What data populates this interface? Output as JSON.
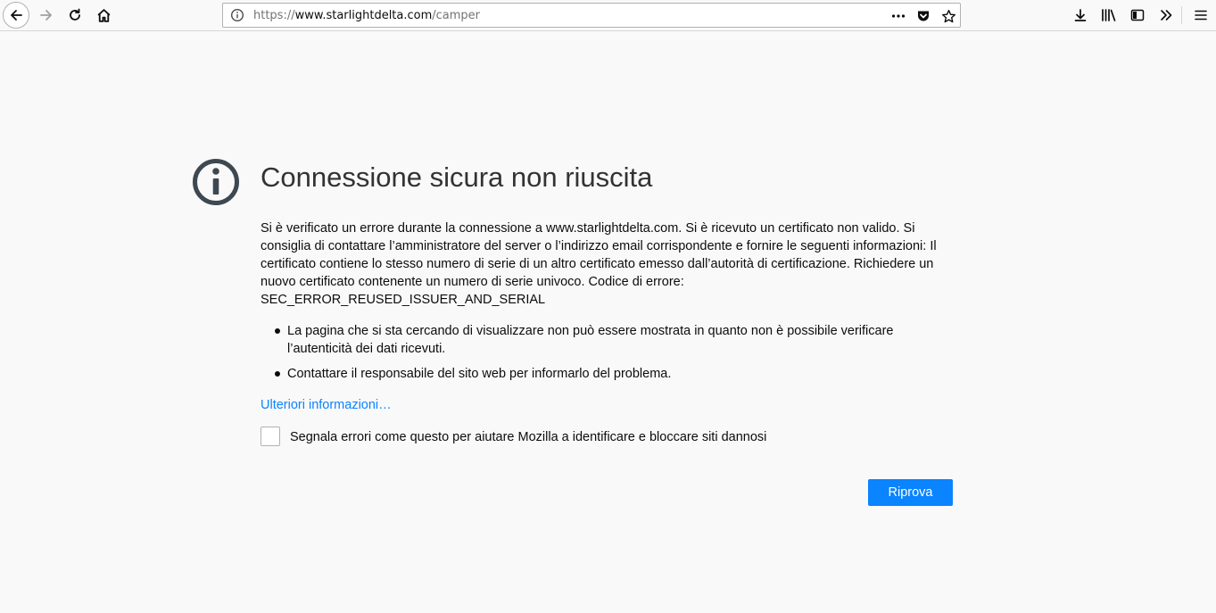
{
  "browser": {
    "url_scheme": "https://",
    "url_host": "www.starlightdelta.com",
    "url_path": "/camper",
    "icons": [
      "back-arrow-icon",
      "forward-arrow-icon",
      "reload-icon",
      "home-icon",
      "info-icon",
      "more-icon",
      "pocket-icon",
      "star-icon",
      "download-icon",
      "library-icon",
      "sidebar-icon",
      "overflow-chevron-icon",
      "hamburger-menu-icon"
    ]
  },
  "error": {
    "icon": "info-circle-icon",
    "title": "Connessione sicura non riuscita",
    "description": "Si è verificato un errore durante la connessione a www.starlightdelta.com. Si è ricevuto un certificato non valido. Si consiglia di contattare l’amministratore del server o l’indirizzo email corrispondente e fornire le seguenti informazioni: Il certificato contiene lo stesso numero di serie di un altro certificato emesso dall’autorità di certificazione. Richiedere un nuovo certificato contenente un numero di serie univoco. Codice di errore:",
    "error_code": "SEC_ERROR_REUSED_ISSUER_AND_SERIAL",
    "bullets": [
      "La pagina che si sta cercando di visualizzare non può essere mostrata in quanto non è possibile verificare l’autenticità dei dati ricevuti.",
      "Contattare il responsabile del sito web per informarlo del problema."
    ],
    "learn_more": "Ulteriori informazioni…",
    "report_label": "Segnala errori come questo per aiutare Mozilla a identificare e bloccare siti dannosi",
    "report_checked": false,
    "retry_label": "Riprova"
  },
  "colors": {
    "accent": "#0a84ff",
    "background": "#f9f9fa",
    "icon": "#3d4850"
  }
}
